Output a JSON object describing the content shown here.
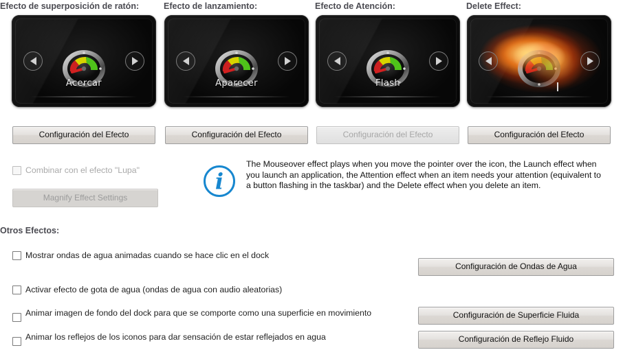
{
  "effects": {
    "group_labels": [
      "Efecto de superposición de ratón:",
      "Efecto de lanzamiento:",
      "Efecto de Atención:",
      "Delete Effect:"
    ],
    "previews": [
      {
        "name": "Acercar",
        "icon": "gauge-icon",
        "fire": false
      },
      {
        "name": "Aparecer",
        "icon": "gauge-icon",
        "fire": false
      },
      {
        "name": "Flash",
        "icon": "gauge-icon",
        "fire": false
      },
      {
        "name": "",
        "icon": "gauge-icon",
        "fire": true
      }
    ],
    "config_buttons": [
      {
        "label": "Configuración del Efecto",
        "enabled": true
      },
      {
        "label": "Configuración del Efecto",
        "enabled": true
      },
      {
        "label": "Configuración del Efecto",
        "enabled": false
      },
      {
        "label": "Configuración del Efecto",
        "enabled": true
      }
    ]
  },
  "magnify": {
    "checkbox_label": "Combinar con el efecto \"Lupa\"",
    "checkbox_checked": false,
    "checkbox_enabled": false,
    "button_label": "Magnify Effect Settings",
    "button_enabled": false
  },
  "info": {
    "icon": "info-icon",
    "accent_color": "#1787cf",
    "text": "The Mouseover effect plays when you move the pointer over the icon, the Launch effect when you launch an application, the Attention effect when an item needs your attention (equivalent to a button flashing in the taskbar) and the Delete effect when you delete an item."
  },
  "other_effects": {
    "title": "Otros Efectos:",
    "items": [
      {
        "label": "Mostrar ondas de agua animadas cuando se hace clic en el dock",
        "checked": false
      },
      {
        "label": "Activar efecto de gota de agua (ondas de agua con audio aleatorias)",
        "checked": false
      },
      {
        "label": "Animar imagen de fondo del dock para que se comporte como una superficie en movimiento",
        "checked": false
      },
      {
        "label": "Animar los reflejos de los iconos para dar sensación de estar reflejados en agua",
        "checked": false
      }
    ],
    "buttons": [
      {
        "label": "Configuración de Ondas de Agua",
        "enabled": true
      },
      {
        "label": "Configuración de Superficie Fluida",
        "enabled": true
      },
      {
        "label": "Configuración de Reflejo Fluido",
        "enabled": true
      }
    ]
  }
}
